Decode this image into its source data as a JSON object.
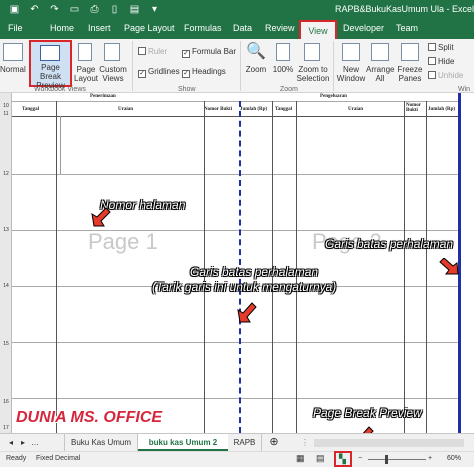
{
  "window": {
    "title": "RAPB&BukuKasUmum Ula - Excel"
  },
  "ribbon_tabs": [
    "File",
    "Home",
    "Insert",
    "Page Layout",
    "Formulas",
    "Data",
    "Review",
    "View",
    "Developer",
    "Team"
  ],
  "ribbon": {
    "normal": "Normal",
    "page_break_preview": "Page Break Preview",
    "page_layout": "Page Layout",
    "custom_views": "Custom Views",
    "workbook_views_group": "Workbook Views",
    "ruler": "Ruler",
    "formula_bar": "Formula Bar",
    "gridlines": "Gridlines",
    "headings": "Headings",
    "show_group": "Show",
    "zoom": "Zoom",
    "zoom_100": "100%",
    "zoom_to_selection": "Zoom to Selection",
    "zoom_group": "Zoom",
    "new_window": "New Window",
    "arrange_all": "Arrange All",
    "freeze_panes": "Freeze Panes",
    "split": "Split",
    "hide": "Hide",
    "unhide": "Unhide",
    "window_group": "Win"
  },
  "sheet": {
    "penerimaan": "Penerimaan",
    "pengeluaran": "Pengeluaran",
    "tanggal": "Tanggal",
    "uraian": "Uraian",
    "nomor_bukti": "Nomor Bukti",
    "jumlah": "Jumlah (Rp)",
    "page1": "Page 1",
    "page2": "Page 2",
    "row_numbers": [
      "10",
      "11",
      "12",
      "13",
      "14",
      "15",
      "16",
      "17"
    ]
  },
  "annotations": {
    "nomor_halaman": "Nomor halaman",
    "garis_batas_perhalaman": "Garis batas perhalaman",
    "garis_line1": "Garis batas perhalaman",
    "garis_line2": "(Tarik garis ini untuk mengaturnya)",
    "page_break_preview": "Page Break Preview"
  },
  "brand": "DUNIA MS. OFFICE",
  "sheet_tabs": [
    "Buku Kas Umum",
    "buku kas Umum 2",
    "RAPB"
  ],
  "status": {
    "ready": "Ready",
    "fixed_decimal": "Fixed Decimal",
    "zoom_level": "60%"
  },
  "colors": {
    "excel_green": "#217346",
    "highlight_red": "#d9262b",
    "page_break_blue": "#1f2fa8",
    "arrow_red": "#e53b2b"
  }
}
